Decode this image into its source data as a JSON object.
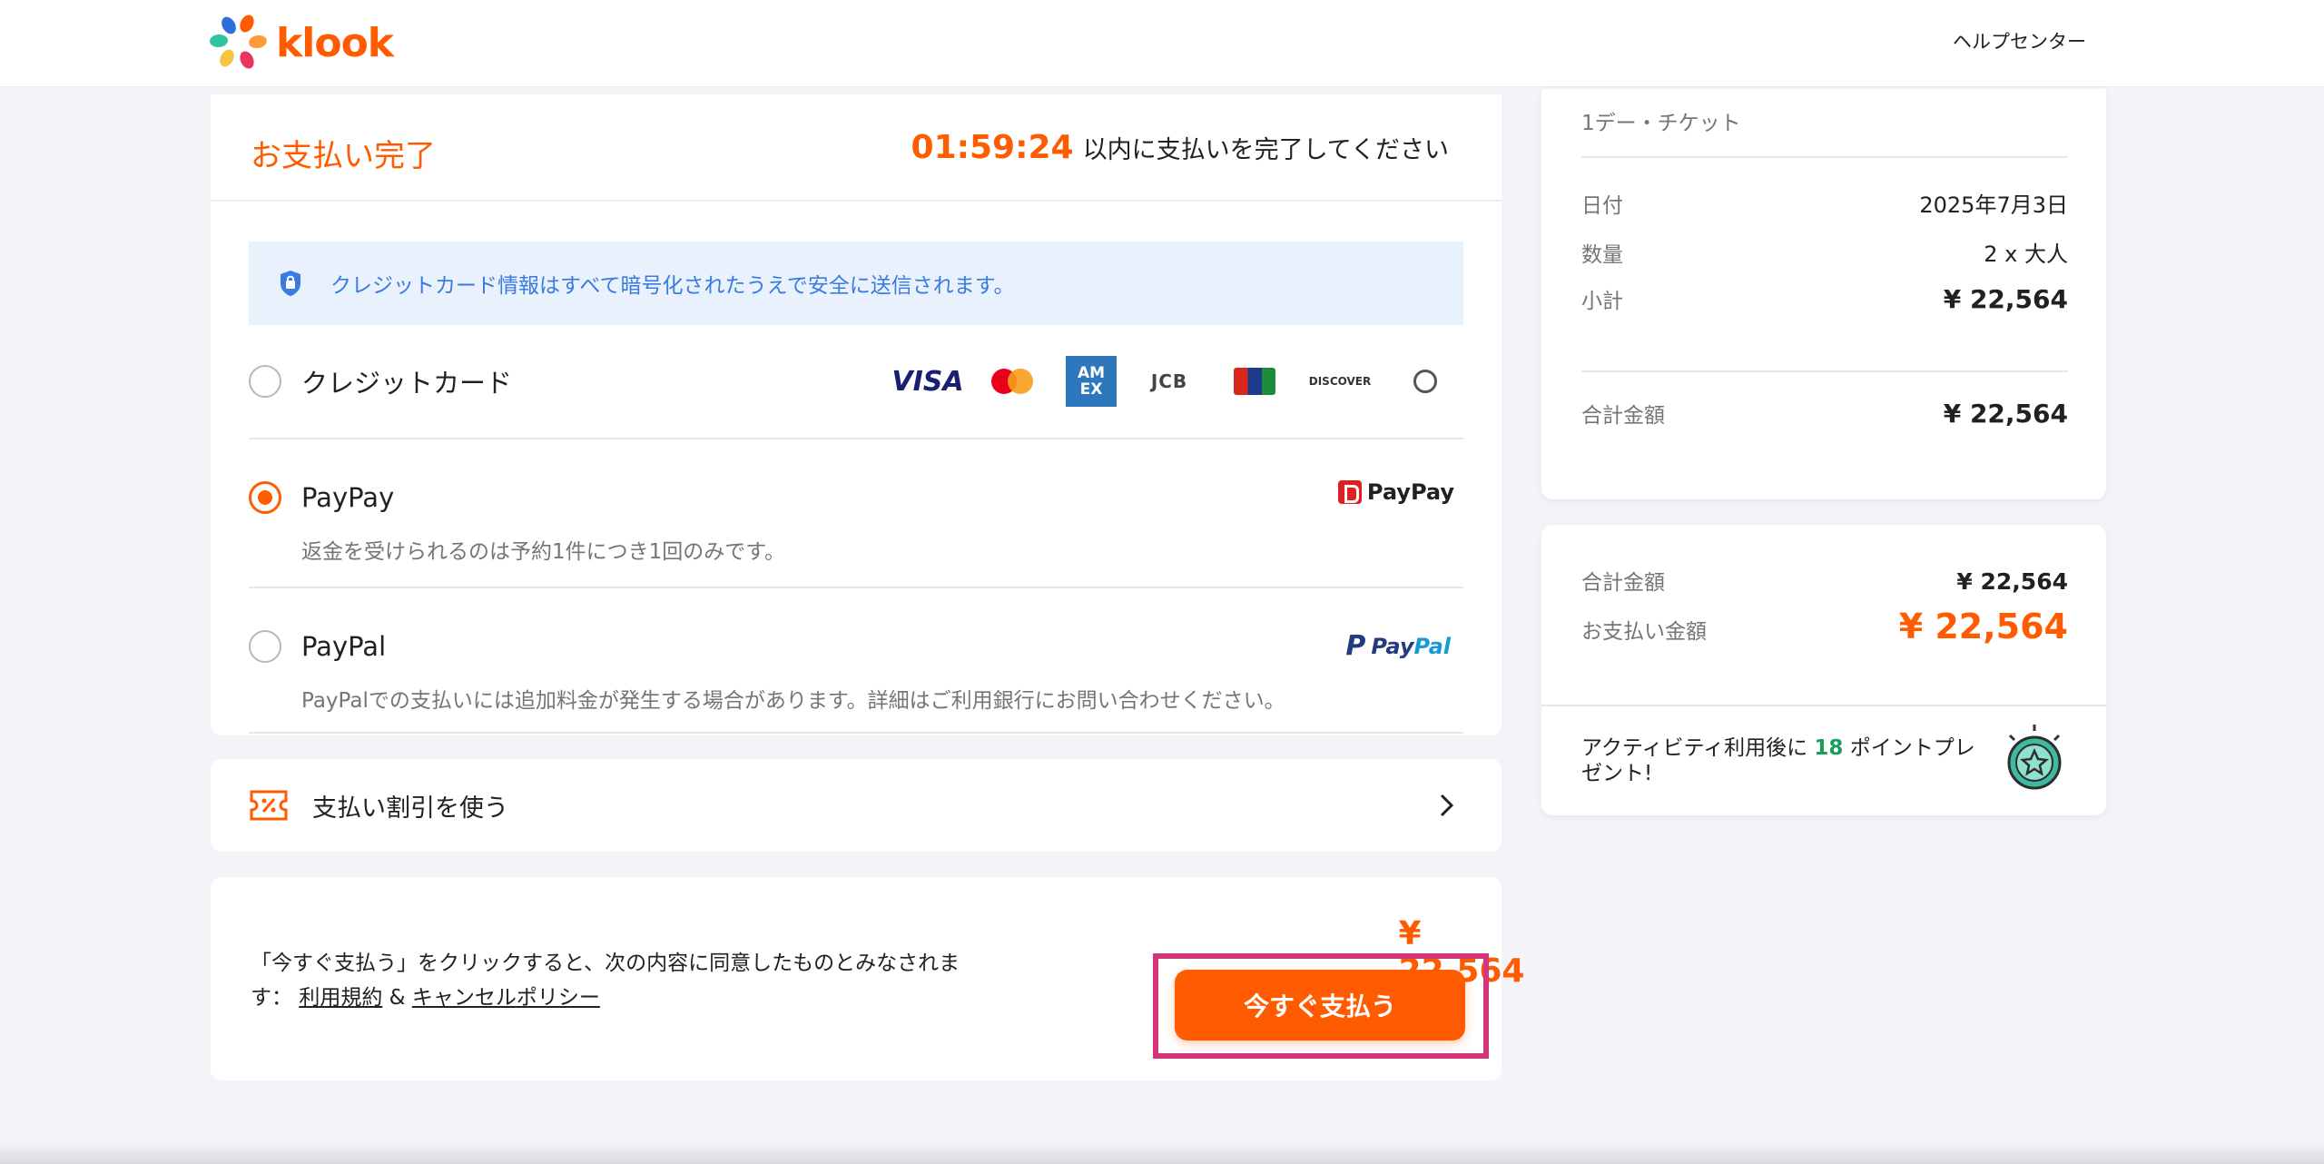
{
  "header": {
    "logo_text": "klook",
    "help_link": "ヘルプセンター"
  },
  "payment": {
    "title": "お支払い完了",
    "countdown_time": "01:59:24",
    "countdown_text": "以内に支払いを完了してください",
    "secure_notice": "クレジットカード情報はすべて暗号化されたうえで安全に送信されます。",
    "methods": [
      {
        "label": "クレジットカード",
        "selected": false,
        "logos": [
          "VISA",
          "Mastercard",
          "AMEX",
          "JCB",
          "UnionPay",
          "DISCOVER",
          "Diners Club"
        ]
      },
      {
        "label": "PayPay",
        "selected": true,
        "logo": "PayPay",
        "note": "返金を受けられるのは予約1件につき1回のみです。"
      },
      {
        "label": "PayPal",
        "selected": false,
        "logo_a": "Pay",
        "logo_b": "Pal",
        "note": "PayPalでの支払いには追加料金が発生する場合があります。詳細はご利用銀行にお問い合わせください。"
      }
    ]
  },
  "discount": {
    "label": "支払い割引を使う"
  },
  "agreement": {
    "text_prefix": "「今すぐ支払う」をクリックすると、次の内容に同意したものとみなされます：",
    "terms_link": "利用規約",
    "amp": "&",
    "policy_link": "キャンセルポリシー",
    "total": "¥ 22,564",
    "pay_button": "今すぐ支払う"
  },
  "summary": {
    "product": "1デー・チケット",
    "rows": [
      {
        "key": "日付",
        "value": "2025年7月3日"
      },
      {
        "key": "数量",
        "value": "2 x 大人"
      },
      {
        "key": "小計",
        "value": "¥ 22,564"
      }
    ],
    "total_label": "合計金額",
    "total_value": "¥ 22,564"
  },
  "totals": {
    "total_label": "合計金額",
    "total_value": "¥ 22,564",
    "pay_amount_label": "お支払い金額",
    "pay_amount_value": "¥ 22,564",
    "points_prefix": "アクティビティ利用後に",
    "points_value": "18",
    "points_suffix": "ポイントプレゼント!"
  },
  "colors": {
    "brand": "#ff5b00",
    "highlight": "#d6357a",
    "notice_bg": "#e9f1fd",
    "notice_text": "#3a7be0",
    "points": "#1b9e5b"
  },
  "icons": [
    "klook-logo-icon",
    "lock-icon",
    "ticket-discount-icon",
    "chevron-right-icon",
    "star-medal-icon"
  ]
}
